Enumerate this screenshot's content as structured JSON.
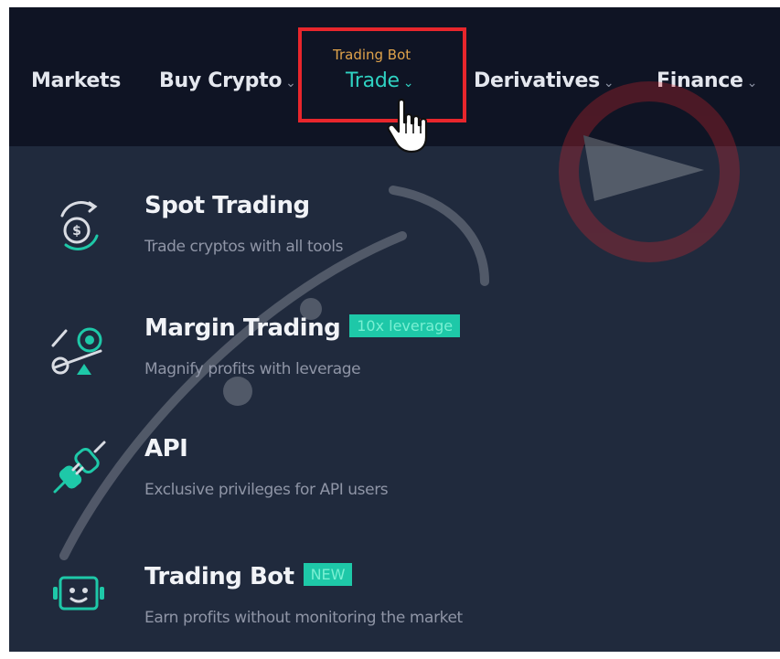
{
  "navbar": {
    "items": [
      {
        "label": "Markets",
        "has_dropdown": false
      },
      {
        "label": "Buy Crypto",
        "has_dropdown": true
      },
      {
        "label": "Trade",
        "has_dropdown": true,
        "active": true
      },
      {
        "label": "Derivatives",
        "has_dropdown": true
      },
      {
        "label": "Finance",
        "has_dropdown": true
      }
    ],
    "trade_badge": "Trading Bot",
    "chevron": "⌄"
  },
  "menu": {
    "items": [
      {
        "icon": "coin-exchange-icon",
        "title": "Spot Trading",
        "tag": "",
        "description": "Trade cryptos with all tools"
      },
      {
        "icon": "balance-scale-icon",
        "title": "Margin Trading",
        "tag": "10x leverage",
        "description": "Magnify profits with leverage"
      },
      {
        "icon": "plug-connector-icon",
        "title": "API",
        "tag": "",
        "description": "Exclusive privileges for API users"
      },
      {
        "icon": "robot-icon",
        "title": "Trading Bot",
        "tag": "NEW",
        "description": "Earn profits without monitoring the market"
      }
    ]
  },
  "colors": {
    "navbar_bg": "#0f1424",
    "menu_bg": "#202a3d",
    "accent": "#2fd2c2",
    "badge": "#e0a34b",
    "highlight": "#e8262c",
    "tag_bg": "#1ec8a8"
  }
}
